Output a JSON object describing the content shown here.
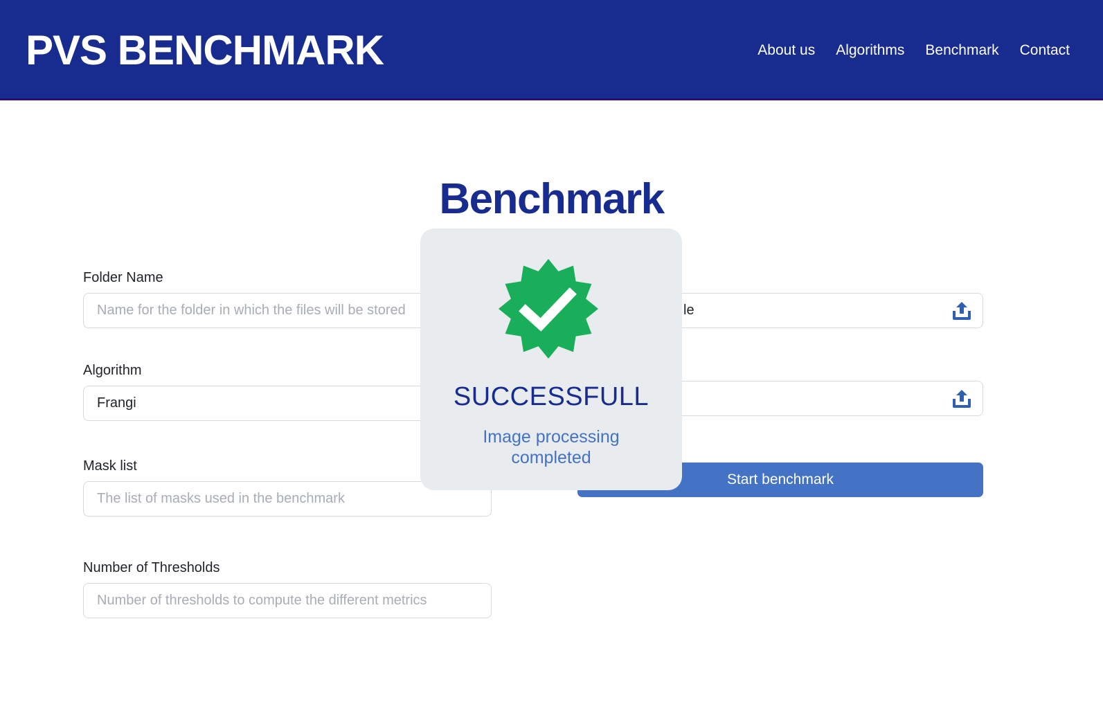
{
  "header": {
    "logo": "PVS BENCHMARK",
    "nav": [
      "About us",
      "Algorithms",
      "Benchmark",
      "Contact"
    ]
  },
  "page": {
    "title": "Benchmark"
  },
  "form": {
    "folder_name": {
      "label": "Folder Name",
      "placeholder": "Name for the folder in which the files will be stored"
    },
    "algorithm": {
      "label": "Algorithm",
      "value": "Frangi"
    },
    "mask_list": {
      "label": "Mask list",
      "placeholder": "The list of masks used in the benchmark"
    },
    "thresholds": {
      "label": "Number of Thresholds",
      "placeholder": "Number of thresholds to compute the different metrics"
    },
    "upload_1": {
      "visible_text": "le",
      "icon": "upload-icon"
    },
    "upload_2": {
      "visible_text": "",
      "icon": "upload-icon"
    },
    "start_button": "Start benchmark"
  },
  "modal": {
    "icon": "verified-badge-icon",
    "title": "SUCCESSFULL",
    "message": "Image processing completed"
  },
  "colors": {
    "header_bg": "#172c8e",
    "title": "#172c8e",
    "accent": "#4472c4",
    "success": "#19ae5a",
    "modal_bg": "#e9ecee"
  }
}
